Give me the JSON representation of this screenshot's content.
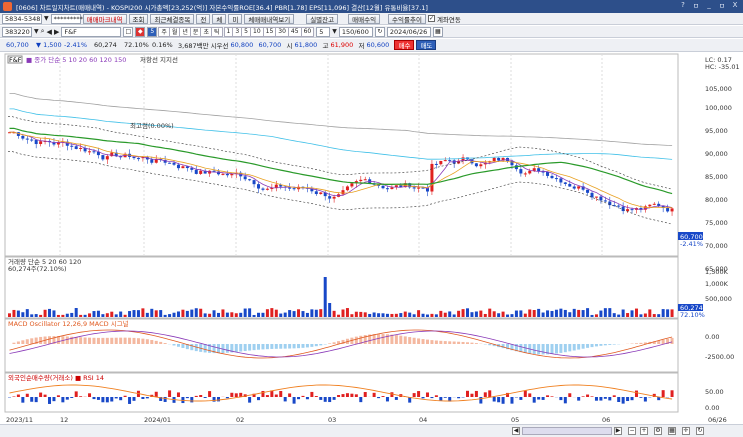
{
  "window": {
    "title": "[0606] 차트일지차트(매매내역) - KOSPI200 시가총액[23,252(억)] 자본수익률ROE[36.4] PBR[1.78] EPS[11,096] 결산[12월] 유통비율[37.1]",
    "buttons": [
      "?",
      "ㅁ",
      "_",
      "ㅁ",
      "X"
    ]
  },
  "toolbar1": {
    "code": "5834-5348",
    "password": "*********",
    "btn_trade_mark": "매매마크내역",
    "btn_query": "조회",
    "btn_reg": "최근체결종목",
    "btn_all": "전",
    "btn_bal": "체",
    "btn_done": "미",
    "btn_trade_view": "체매매내역보기",
    "btn_real_balance": "실별잔고",
    "btn_trade_profit": "매매수익",
    "btn_profit_rate": "수익률추이",
    "chk_account": "계좌연동",
    "chk_account_checked": "✓"
  },
  "toolbar2": {
    "stock_code": "383220",
    "stock_name": "F&F",
    "period_btn": "5",
    "period_labels": [
      "주",
      "월",
      "년",
      "분",
      "초",
      "틱"
    ],
    "numbers": [
      "1",
      "3",
      "5",
      "10",
      "15",
      "30",
      "45",
      "60"
    ],
    "count": "150/600",
    "date": "2024/06/26"
  },
  "toolbar3": {
    "price": "60,700",
    "change": "▼ 1,500",
    "change_pct": "-2.41%",
    "volume": "60,274",
    "vol_pct": "72.10%",
    "rate": "0.16%",
    "amount": "3,687백만",
    "open_label": "시우선",
    "open_val": "60,800",
    "cur_val": "60,700",
    "high_label": "시",
    "high_val": "61,800",
    "hi_label": "고",
    "hi_val": "61,900",
    "low_label": "저",
    "low_val": "60,600",
    "buy_btn": "매수",
    "sell_btn": "매도"
  },
  "price_panel": {
    "legend_name": "F&F",
    "legend_ma": "■ 종가 단순 5 10 20 60 120 150",
    "legend_extra": "저항선 지지선",
    "annotation": "최고점(0.00%)",
    "right_top": "LC: 0.17",
    "right_top2": "HC: -35.01",
    "current_label": "60,700",
    "pct_label": "-2.41%",
    "ticks": [
      "105,000",
      "100,000",
      "95,000",
      "90,000",
      "85,000",
      "80,000",
      "75,000",
      "70,000",
      "65,000"
    ]
  },
  "volume_panel": {
    "legend": "거래량 단순 5 20 60 120",
    "vol_label": "60,274주(72.10%)",
    "ticks": [
      "1,500K",
      "1,000K",
      "500,000"
    ],
    "current": "60,274",
    "pct": "72.10%"
  },
  "macd_panel": {
    "legend": "MACD Oscillator 12,26,9 MACD 시그널",
    "ticks": [
      "0.00",
      "-2500.00"
    ]
  },
  "foreign_panel": {
    "legend": "외국인순매수량(거래소) ■ RSI 14",
    "ticks": [
      "50.00",
      "0.00"
    ]
  },
  "xaxis": {
    "labels": [
      "2023/11",
      "12",
      "2024/01",
      "02",
      "03",
      "04",
      "05",
      "06",
      "06/26"
    ]
  },
  "colors": {
    "up": "#e02020",
    "down": "#1848c8",
    "ma5": "#8a3ab8",
    "ma10": "#e8a020",
    "ma20": "#2a9a2a",
    "ma60": "#40c0e8",
    "ma120": "#a0a0a0"
  }
}
